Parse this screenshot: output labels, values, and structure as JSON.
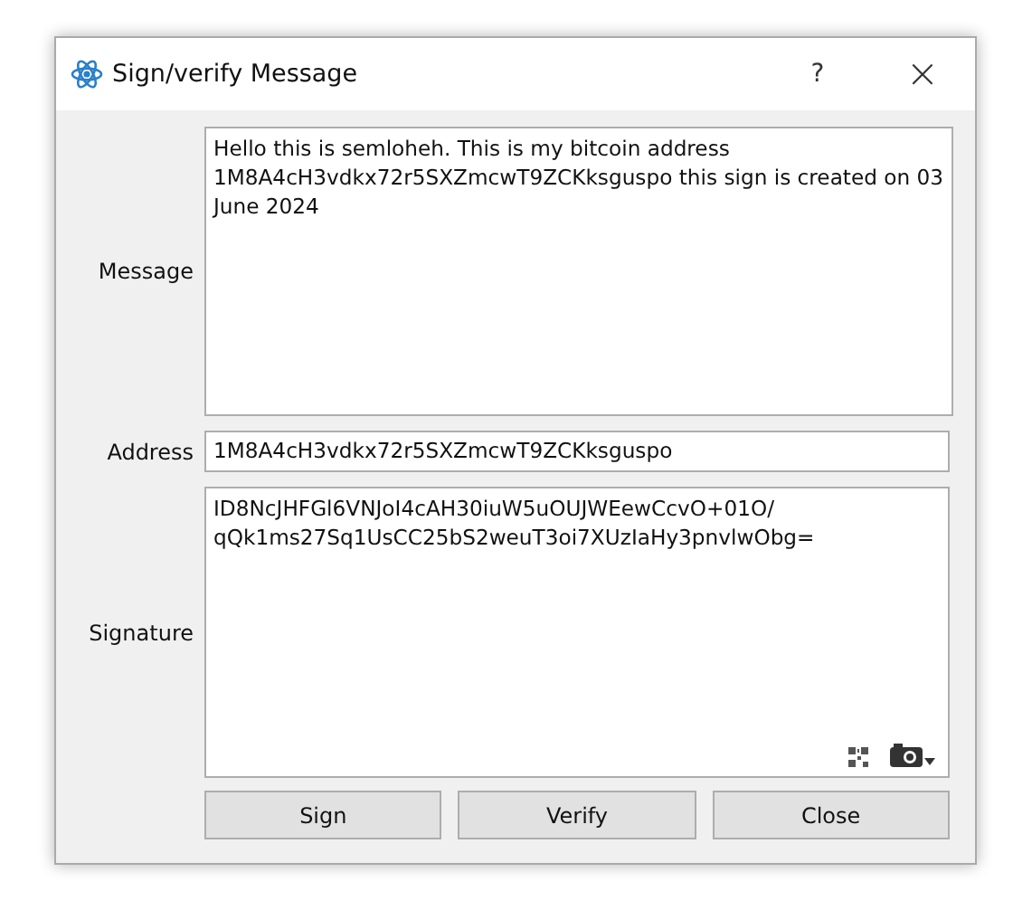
{
  "window": {
    "title": "Sign/verify Message",
    "help": "?",
    "close": "×"
  },
  "message": {
    "label": "Message",
    "lines": [
      "Hello this is semloheh. This is my bitcoin address",
      "1M8A4cH3vdkx72r5SXZmcwT9ZCKksguspo this sign is created on 03",
      "June 2024"
    ]
  },
  "address": {
    "label": "Address",
    "value": "1M8A4cH3vdkx72r5SXZmcwT9ZCKksguspo"
  },
  "signature": {
    "label": "Signature",
    "lines": [
      "ID8NcJHFGl6VNJoI4cAH30iuW5uOUJWEewCcvO+01O/",
      "qQk1ms27Sq1UsCC25bS2weuT3oi7XUzIaHy3pnvlwObg="
    ]
  },
  "buttons": [
    "Sign",
    "Verify",
    "Close"
  ]
}
